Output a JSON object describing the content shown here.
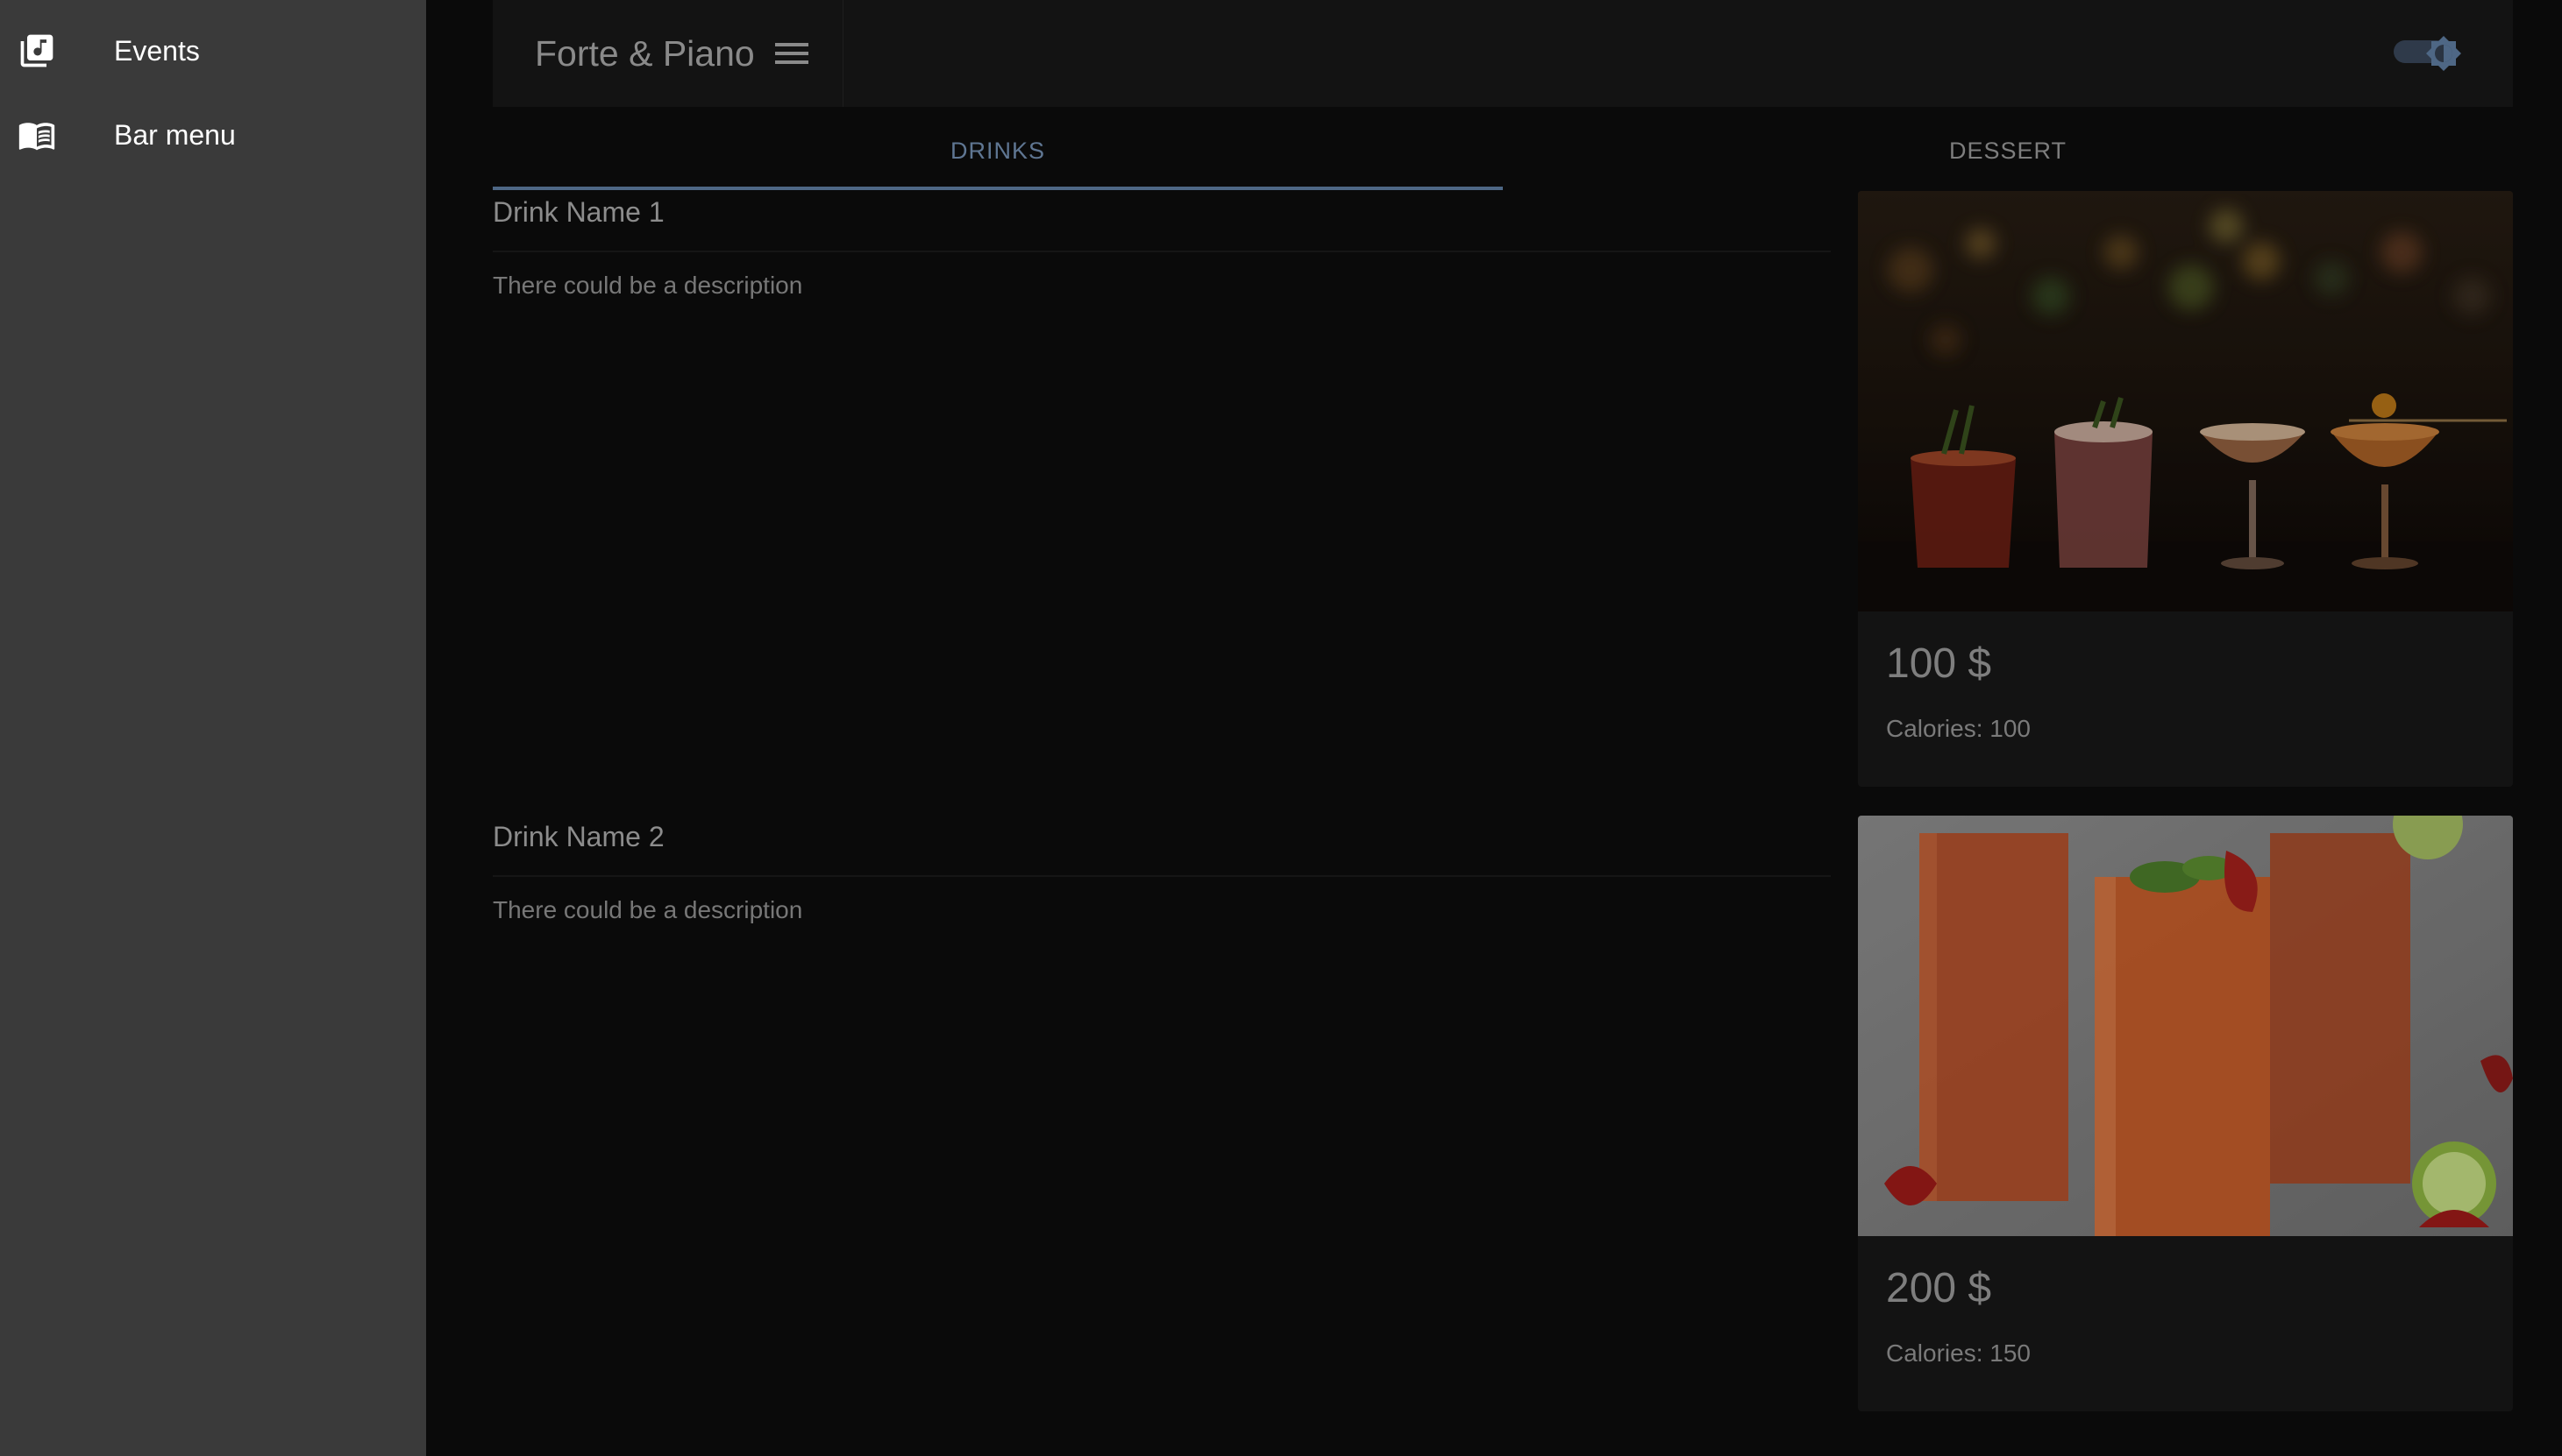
{
  "sidebar": {
    "items": [
      {
        "label": "Events",
        "icon": "music-library-icon"
      },
      {
        "label": "Bar menu",
        "icon": "menu-book-icon"
      }
    ]
  },
  "appbar": {
    "title": "Forte & Piano",
    "menu_icon": "hamburger-menu-icon",
    "theme_toggle_icon": "brightness-icon"
  },
  "tabs": [
    {
      "label": "DRINKS",
      "selected": true
    },
    {
      "label": "DESSERT",
      "selected": false
    }
  ],
  "drinks": [
    {
      "name": "Drink Name 1",
      "description": "There could be a description",
      "price": "100 $",
      "calories": "Calories: 100"
    },
    {
      "name": "Drink Name 2",
      "description": "There could be a description",
      "price": "200 $",
      "calories": "Calories: 150"
    }
  ],
  "colors": {
    "background": "#0a0a0a",
    "sidebar": "#3a3a3a",
    "accent": "#4e6785"
  }
}
